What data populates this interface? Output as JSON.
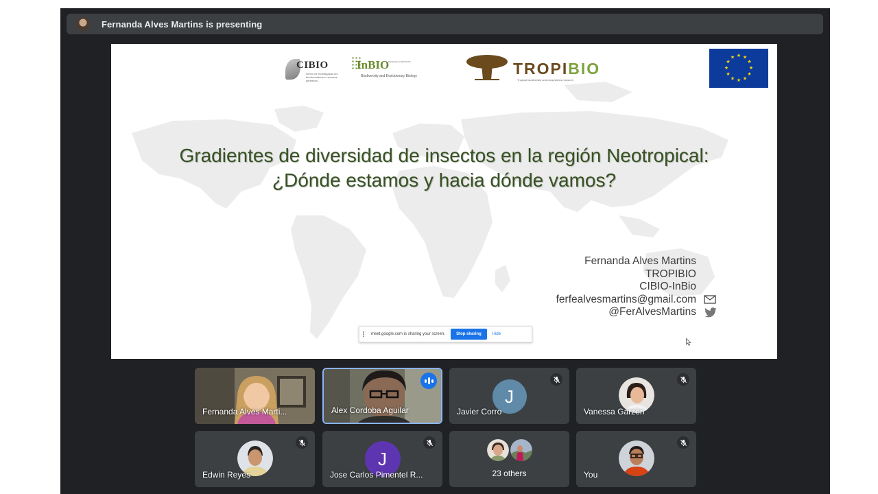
{
  "presenting_bar": {
    "text": "Fernanda Alves Martins is presenting"
  },
  "slide": {
    "logos": {
      "cibio_name": "CIBIO",
      "cibio_sub": "centro de investigação em biodiversidade e recursos genéticos",
      "inbio_name": "InBIO",
      "inbio_sub": "Biodiversity and Evolutionary Biology",
      "inbio_sub2": "RESEARCH NETWORK",
      "tropibio_tropi": "TROPI",
      "tropibio_bio": "BIO",
      "tropibio_sub": "Tropical biodiversity and ecosystems research"
    },
    "title_line1": "Gradientes de diversidad de insectos en la región Neotropical:",
    "title_line2": "¿Dónde estamos y hacia dónde vamos?",
    "author": {
      "name": "Fernanda Alves Martins",
      "org1": "TROPIBIO",
      "org2": "CIBIO-InBio",
      "email": "ferfealvesmartins@gmail.com",
      "twitter": "@FerAlvesMartins"
    },
    "share_banner": {
      "message": "meet.google.com is sharing your screen.",
      "stop_label": "Stop sharing",
      "hide_label": "Hide"
    }
  },
  "participants": [
    {
      "name": "Fernanda Alves Marti...",
      "muted": false,
      "type": "video"
    },
    {
      "name": "Alex Cordoba Aguilar",
      "muted": false,
      "type": "video",
      "speaking": true
    },
    {
      "name": "Javier Corro",
      "muted": true,
      "type": "initial",
      "initial": "J",
      "color": "#5f8aa8"
    },
    {
      "name": "Vanessa Garzón",
      "muted": true,
      "type": "photo"
    },
    {
      "name": "Edwin Reyes",
      "muted": true,
      "type": "photo"
    },
    {
      "name": "Jose Carlos Pimentel R...",
      "muted": true,
      "type": "initial",
      "initial": "J",
      "color": "#5e35b1"
    },
    {
      "name": "23 others",
      "type": "others"
    },
    {
      "name": "You",
      "muted": true,
      "type": "photo"
    }
  ],
  "colors": {
    "meet_bg": "#202124",
    "tile_bg": "#3c4043",
    "title_green": "#375223",
    "accent_blue": "#1a73e8",
    "eu_blue": "#0d3b9b",
    "eu_star": "#ffdd00"
  }
}
